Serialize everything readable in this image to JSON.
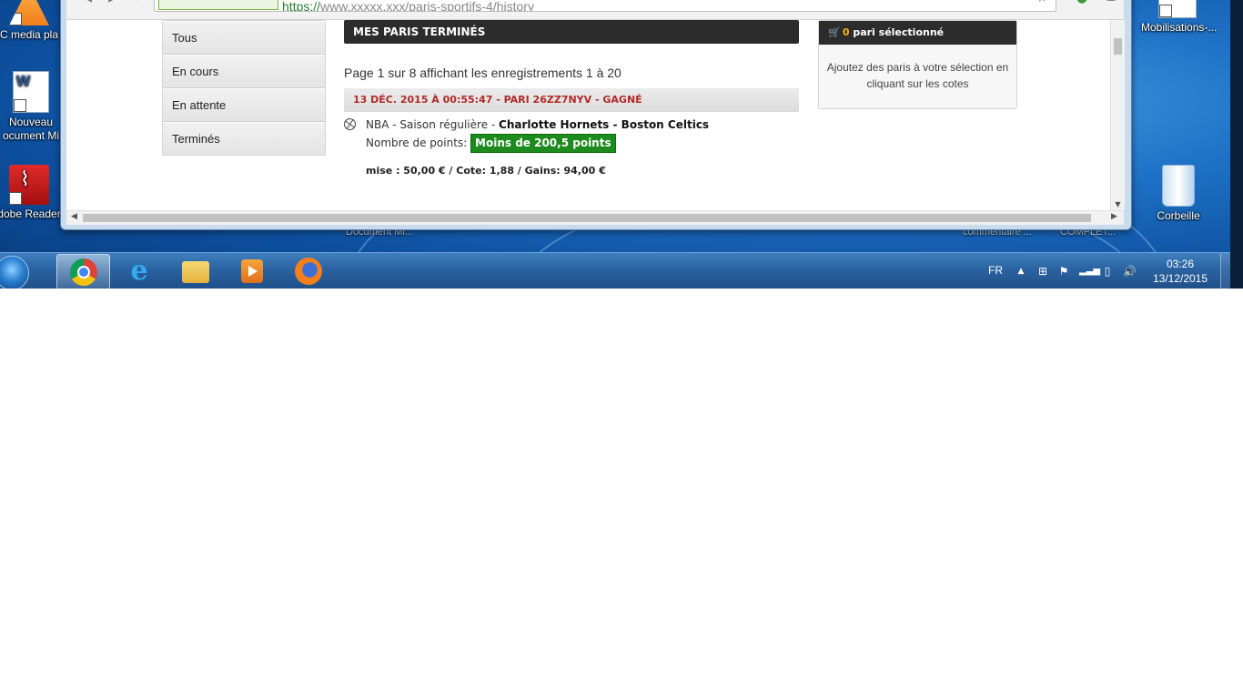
{
  "desktop": {
    "icons": [
      {
        "label": "C media pla"
      },
      {
        "label": "Nouveau\nocument Mi"
      },
      {
        "label": "dobe Reader"
      },
      {
        "label": "Mobilisations-..."
      },
      {
        "label": "Corbeille"
      }
    ],
    "ghost_labels": [
      "Document Mi...",
      "commentaire ...",
      "COMPLET..."
    ]
  },
  "browser": {
    "url_scheme": "https://",
    "url_host": "www.xxxxx.xxx",
    "url_path": "/paris-sportifs-4/history",
    "page": {
      "menu": [
        "Tous",
        "En cours",
        "En attente",
        "Terminés"
      ],
      "section_title": "MES PARIS TERMINÉS",
      "pager": "Page 1 sur 8 affichant les enregistrements 1 à 20",
      "bet": {
        "header": "13 DÉC. 2015 À 00:55:47 - PARI 26ZZ7NYV - GAGNÉ",
        "competition": "NBA - Saison régulière - ",
        "home_team": "Charlotte Hornets",
        "separator": " - ",
        "away_team": "Boston Celtics",
        "market_label": "Nombre de points: ",
        "selection": "Moins de 200,5 points",
        "stake_line": "mise : 50,00 € / Cote: 1,88 / Gains: 94,00 €"
      },
      "slip": {
        "count": "0",
        "title_suffix": " pari sélectionné",
        "body": "Ajoutez des paris à votre sélection en cliquant sur les cotes"
      }
    }
  },
  "taskbar": {
    "apps": [
      "chrome-icon",
      "internet-explorer-icon",
      "file-explorer-icon",
      "media-player-icon",
      "firefox-icon"
    ],
    "language": "FR",
    "time": "03:26",
    "date": "13/12/2015"
  },
  "colors": {
    "won_text": "#b22a2a",
    "selection_bg": "#1d8a1d",
    "slip_count": "#f2b705",
    "header_bg": "#2c2c2c"
  }
}
